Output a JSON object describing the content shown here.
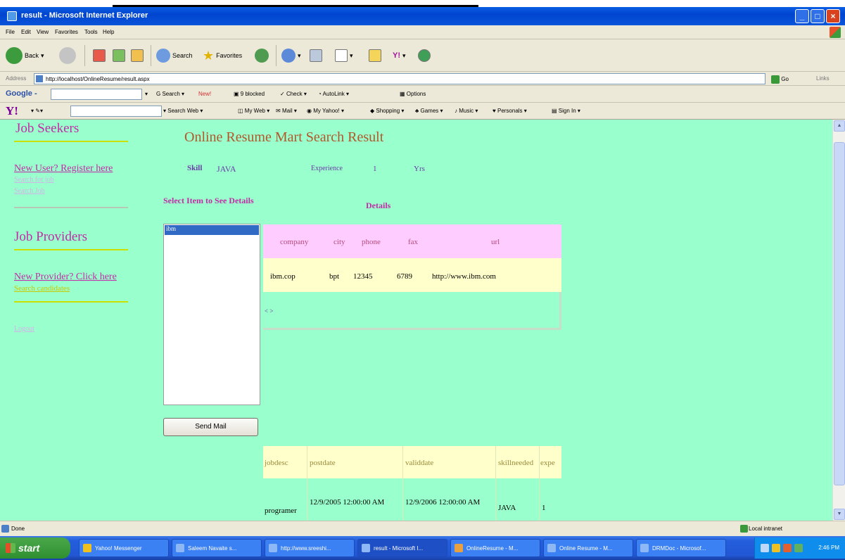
{
  "window": {
    "title": "result - Microsoft Internet Explorer"
  },
  "menu": [
    "File",
    "Edit",
    "View",
    "Favorites",
    "Tools",
    "Help"
  ],
  "toolbar": {
    "back": "Back",
    "search": "Search",
    "favorites": "Favorites"
  },
  "address": {
    "label": "Address",
    "url": "http://localhost/OnlineResume/result.aspx",
    "go": "Go",
    "links": "Links"
  },
  "google": {
    "logo": "Google -",
    "search": "Search",
    "new_badge": "New!",
    "blocked": "9 blocked",
    "check": "Check",
    "autolink": "AutoLink",
    "options": "Options"
  },
  "yahoo": {
    "logo": "Y!",
    "search_web": "Search Web",
    "my_web": "My Web",
    "mail": "Mail",
    "my_yahoo": "My Yahoo!",
    "shopping": "Shopping",
    "games": "Games",
    "music": "Music",
    "personals": "Personals",
    "sign_in": "Sign In"
  },
  "sidebar": {
    "job_seekers": "Job Seekers",
    "new_user": "New User? Register here",
    "faint1": "Search for job",
    "faint2": "Search Job",
    "job_providers": "Job Providers",
    "new_provider": "New Provider? Click here",
    "search_candidates": "Search candidates",
    "logout": "Logout"
  },
  "main": {
    "title": "Online Resume Mart Search Result",
    "skill_label": "Skill",
    "skill_value": "JAVA",
    "experience_label": "Experience",
    "experience_value": "1",
    "yrs": "Yrs",
    "select_item": "Select Item to See Details",
    "details_label": "Details",
    "list_selected": "ibm",
    "send_mail": "Send Mail"
  },
  "details_table": {
    "headers": [
      "company",
      "city",
      "phone",
      "fax",
      "url"
    ],
    "row": [
      "ibm.cop",
      "bpt",
      "12345",
      "6789",
      "http://www.ibm.com"
    ],
    "pager": "< >"
  },
  "jobs_table": {
    "headers": [
      "jobdesc",
      "postdate",
      "validdate",
      "skillneeded",
      "expe"
    ],
    "row": [
      "programer",
      "12/9/2005 12:00:00 AM",
      "12/9/2006 12:00:00 AM",
      "JAVA",
      "1"
    ]
  },
  "status": {
    "left": "Done",
    "zone": "Local intranet"
  },
  "taskbar": {
    "start": "start",
    "items": [
      "Yahoo! Messenger",
      "Saleem Navaite s...",
      "http://www.sreeshi...",
      "result - Microsoft I...",
      "OnlineResume - M...",
      "Online Resume - M...",
      "DRMDoc - Microsof..."
    ],
    "clock": "2:46 PM"
  }
}
